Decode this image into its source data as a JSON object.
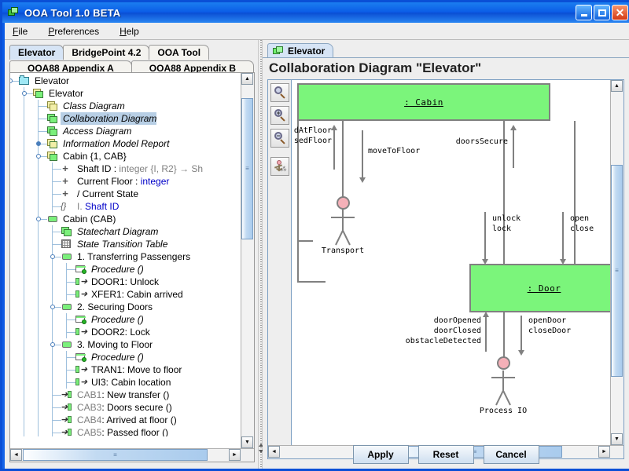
{
  "window": {
    "title": "OOA Tool 1.0 BETA",
    "icon": "app-windows-icon",
    "buttons": {
      "minimize": "_",
      "maximize": "□",
      "close": "✕"
    }
  },
  "menubar": {
    "items": [
      "File",
      "Preferences",
      "Help"
    ]
  },
  "left": {
    "tabs_row1": [
      {
        "label": "Elevator",
        "selected": true
      },
      {
        "label": "BridgePoint 4.2",
        "selected": false
      },
      {
        "label": "OOA Tool",
        "selected": false
      }
    ],
    "tabs_row2": [
      {
        "label": "OOA88 Appendix A",
        "selected": false
      },
      {
        "label": "OOA88 Appendix B",
        "selected": false
      }
    ],
    "tree": [
      {
        "label": "Elevator",
        "icon": "folder-icon",
        "depth": 1,
        "style": "plain",
        "expander": "open",
        "selected": false
      },
      {
        "label": "Elevator",
        "icon": "domain-stack-icon",
        "depth": 2,
        "style": "plain",
        "expander": "open",
        "selected": false
      },
      {
        "label": "Class Diagram",
        "icon": "class-diagram-icon",
        "depth": 3,
        "style": "italic",
        "expander": "none",
        "selected": false
      },
      {
        "label": "Collaboration Diagram",
        "icon": "collaboration-diagram-icon",
        "depth": 3,
        "style": "italic",
        "expander": "none",
        "selected": true
      },
      {
        "label": "Access Diagram",
        "icon": "access-diagram-icon",
        "depth": 3,
        "style": "italic",
        "expander": "none",
        "selected": false
      },
      {
        "label": "Information Model Report",
        "icon": "report-icon",
        "depth": 3,
        "style": "italic",
        "expander": "closed",
        "selected": false
      },
      {
        "label": "Cabin {1, CAB}",
        "icon": "object-stack-icon",
        "depth": 3,
        "style": "plain",
        "expander": "open",
        "selected": false
      },
      {
        "label": "Shaft ID : integer {I, R2} → Sh",
        "icon": "plus-attr-icon",
        "depth": 4,
        "style": "attr-shaftid",
        "expander": "none",
        "selected": false
      },
      {
        "label": "Current Floor : integer",
        "icon": "plus-attr-icon",
        "depth": 4,
        "style": "attr-currentfloor",
        "expander": "none",
        "selected": false
      },
      {
        "label": "/ Current State",
        "icon": "plus-attr-icon",
        "depth": 4,
        "style": "plain",
        "expander": "none",
        "selected": false
      },
      {
        "label": "I. Shaft ID",
        "icon": "braces-icon",
        "depth": 4,
        "style": "ident",
        "expander": "none",
        "selected": false
      },
      {
        "label": "Cabin (CAB)",
        "icon": "green-rect-icon",
        "depth": 3,
        "style": "plain",
        "expander": "open",
        "selected": false
      },
      {
        "label": "Statechart Diagram",
        "icon": "statechart-icon",
        "depth": 4,
        "style": "italic",
        "expander": "none",
        "selected": false
      },
      {
        "label": "State Transition Table",
        "icon": "table-icon",
        "depth": 4,
        "style": "italic",
        "expander": "none",
        "selected": false
      },
      {
        "label": "1. Transferring Passengers",
        "icon": "state-icon",
        "depth": 4,
        "style": "plain",
        "expander": "open",
        "selected": false
      },
      {
        "label": "Procedure ()",
        "icon": "procedure-icon",
        "depth": 5,
        "style": "italic",
        "expander": "none",
        "selected": false
      },
      {
        "label": "DOOR1: Unlock",
        "icon": "outgoing-event-icon",
        "depth": 5,
        "style": "plain",
        "expander": "none",
        "selected": false
      },
      {
        "label": "XFER1: Cabin arrived",
        "icon": "outgoing-event-icon",
        "depth": 5,
        "style": "plain",
        "expander": "none",
        "selected": false
      },
      {
        "label": "2. Securing Doors",
        "icon": "state-icon",
        "depth": 4,
        "style": "plain",
        "expander": "open",
        "selected": false
      },
      {
        "label": "Procedure ()",
        "icon": "procedure-icon",
        "depth": 5,
        "style": "italic",
        "expander": "none",
        "selected": false
      },
      {
        "label": "DOOR2: Lock",
        "icon": "outgoing-event-icon",
        "depth": 5,
        "style": "plain",
        "expander": "none",
        "selected": false
      },
      {
        "label": "3. Moving to Floor",
        "icon": "state-icon",
        "depth": 4,
        "style": "plain",
        "expander": "open",
        "selected": false
      },
      {
        "label": "Procedure ()",
        "icon": "procedure-icon",
        "depth": 5,
        "style": "italic",
        "expander": "none",
        "selected": false
      },
      {
        "label": "TRAN1: Move to floor",
        "icon": "outgoing-event-icon",
        "depth": 5,
        "style": "plain",
        "expander": "none",
        "selected": false
      },
      {
        "label": "UI3: Cabin location",
        "icon": "outgoing-event-icon",
        "depth": 5,
        "style": "plain",
        "expander": "none",
        "selected": false
      },
      {
        "label": "CAB1: New transfer ()",
        "icon": "incoming-event-icon",
        "depth": 4,
        "style": "evt-gray",
        "expander": "none",
        "selected": false
      },
      {
        "label": "CAB3: Doors secure ()",
        "icon": "incoming-event-icon",
        "depth": 4,
        "style": "evt-gray",
        "expander": "none",
        "selected": false
      },
      {
        "label": "CAB4: Arrived at floor ()",
        "icon": "incoming-event-icon",
        "depth": 4,
        "style": "evt-gray",
        "expander": "none",
        "selected": false
      },
      {
        "label": "CAB5: Passed floor ()",
        "icon": "incoming-event-icon",
        "depth": 4,
        "style": "evt-gray",
        "expander": "none",
        "selected": false
      }
    ],
    "tree_text_parts": {
      "shaftid_name": "Shaft ID : ",
      "shaftid_type": "integer {I, R2} → Sh",
      "currentfloor_name": "Current Floor : ",
      "currentfloor_type": "integer",
      "ident_prefix": "I. ",
      "ident_name": "Shaft ID",
      "evt_split": ": "
    }
  },
  "right": {
    "tab": {
      "label": "Elevator",
      "icon": "collaboration-diagram-icon"
    },
    "diagram_title": "Collaboration Diagram \"Elevator\"",
    "tools": [
      {
        "name": "zoom-normal-tool",
        "icon": "magnifier-icon",
        "sign": ""
      },
      {
        "name": "zoom-in-tool",
        "icon": "magnifier-plus-icon",
        "sign": "+"
      },
      {
        "name": "zoom-out-tool",
        "icon": "magnifier-minus-icon",
        "sign": "−"
      },
      {
        "name": "actor-tool",
        "icon": "actor-icon",
        "sign": ""
      }
    ],
    "diagram": {
      "objects": [
        {
          "name": "cabin-object",
          "label": ": Cabin"
        },
        {
          "name": "door-object",
          "label": ": Door"
        }
      ],
      "actors": [
        {
          "name": "transport-actor",
          "label": "Transport"
        },
        {
          "name": "process-io-actor",
          "label": "Process IO"
        }
      ],
      "messages": [
        {
          "name": "arrived-at-floor-message",
          "label": "dAtFloor",
          "direction": "up"
        },
        {
          "name": "passed-floor-message",
          "label": "sedFloor",
          "direction": "up"
        },
        {
          "name": "move-to-floor-message",
          "label": "moveToFloor",
          "direction": "down"
        },
        {
          "name": "doors-secure-message",
          "label": "doorsSecure",
          "direction": "up"
        },
        {
          "name": "unlock-message",
          "label": "unlock",
          "direction": "down"
        },
        {
          "name": "lock-message",
          "label": "lock",
          "direction": "down"
        },
        {
          "name": "open-message",
          "label": "open",
          "direction": "down"
        },
        {
          "name": "close-message",
          "label": "close",
          "direction": "down"
        },
        {
          "name": "door-opened-message",
          "label": "doorOpened",
          "direction": "up"
        },
        {
          "name": "door-closed-message",
          "label": "doorClosed",
          "direction": "up"
        },
        {
          "name": "obstacle-detected-message",
          "label": "obstacleDetected",
          "direction": "up"
        },
        {
          "name": "open-door-message",
          "label": "openDoor",
          "direction": "down"
        },
        {
          "name": "close-door-message",
          "label": "closeDoor",
          "direction": "down"
        }
      ]
    },
    "buttons": [
      {
        "name": "apply-button",
        "label": "Apply"
      },
      {
        "name": "reset-button",
        "label": "Reset"
      },
      {
        "name": "cancel-button",
        "label": "Cancel"
      }
    ]
  },
  "scroll": {
    "up": "▲",
    "down": "▼",
    "left": "◄",
    "right": "►",
    "grip": "≡"
  },
  "colors": {
    "titlebar": "#0a5ce8",
    "object_fill": "#7bf57b",
    "object_border": "#808080",
    "actor_head": "#f5b0b8",
    "selection": "#b8cfe5",
    "tab_selected": "#d6e4f5",
    "link_blue": "#0000c8"
  }
}
